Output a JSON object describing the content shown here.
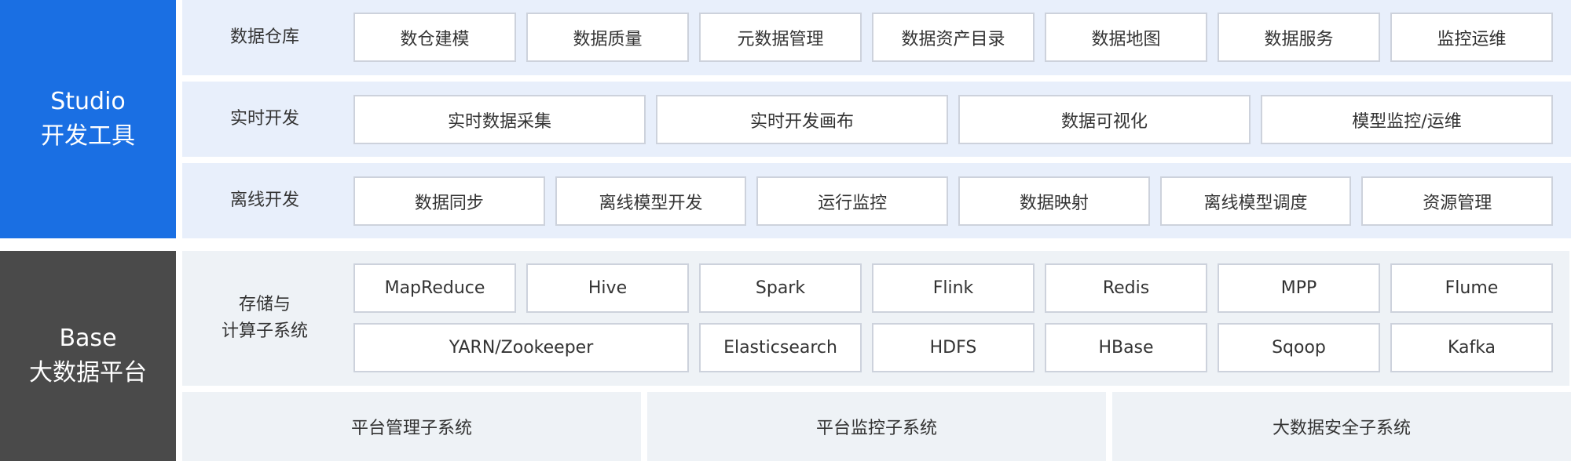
{
  "studio": {
    "title_en": "Studio",
    "title_cn": "开发工具",
    "color": "#1a6fe3",
    "rows": [
      {
        "label": "数据仓库",
        "items": [
          "数仓建模",
          "数据质量",
          "元数据管理",
          "数据资产目录",
          "数据地图",
          "数据服务",
          "监控运维"
        ]
      },
      {
        "label": "实时开发",
        "items": [
          "实时数据采集",
          "实时开发画布",
          "数据可视化",
          "模型监控/运维"
        ]
      },
      {
        "label": "离线开发",
        "items": [
          "数据同步",
          "离线模型开发",
          "运行监控",
          "数据映射",
          "离线模型调度",
          "资源管理"
        ]
      }
    ]
  },
  "base": {
    "title_en": "Base",
    "title_cn": "大数据平台",
    "color": "#4a4a4a",
    "storage": {
      "label_line1": "存储与",
      "label_line2": "计算子系统",
      "row1": [
        "MapReduce",
        "Hive",
        "Spark",
        "Flink",
        "Redis",
        "MPP",
        "Flume"
      ],
      "row2": [
        "YARN/Zookeeper",
        "Elasticsearch",
        "HDFS",
        "HBase",
        "Sqoop",
        "Kafka"
      ]
    },
    "subsystems": [
      "平台管理子系统",
      "平台监控子系统",
      "大数据安全子系统"
    ]
  }
}
